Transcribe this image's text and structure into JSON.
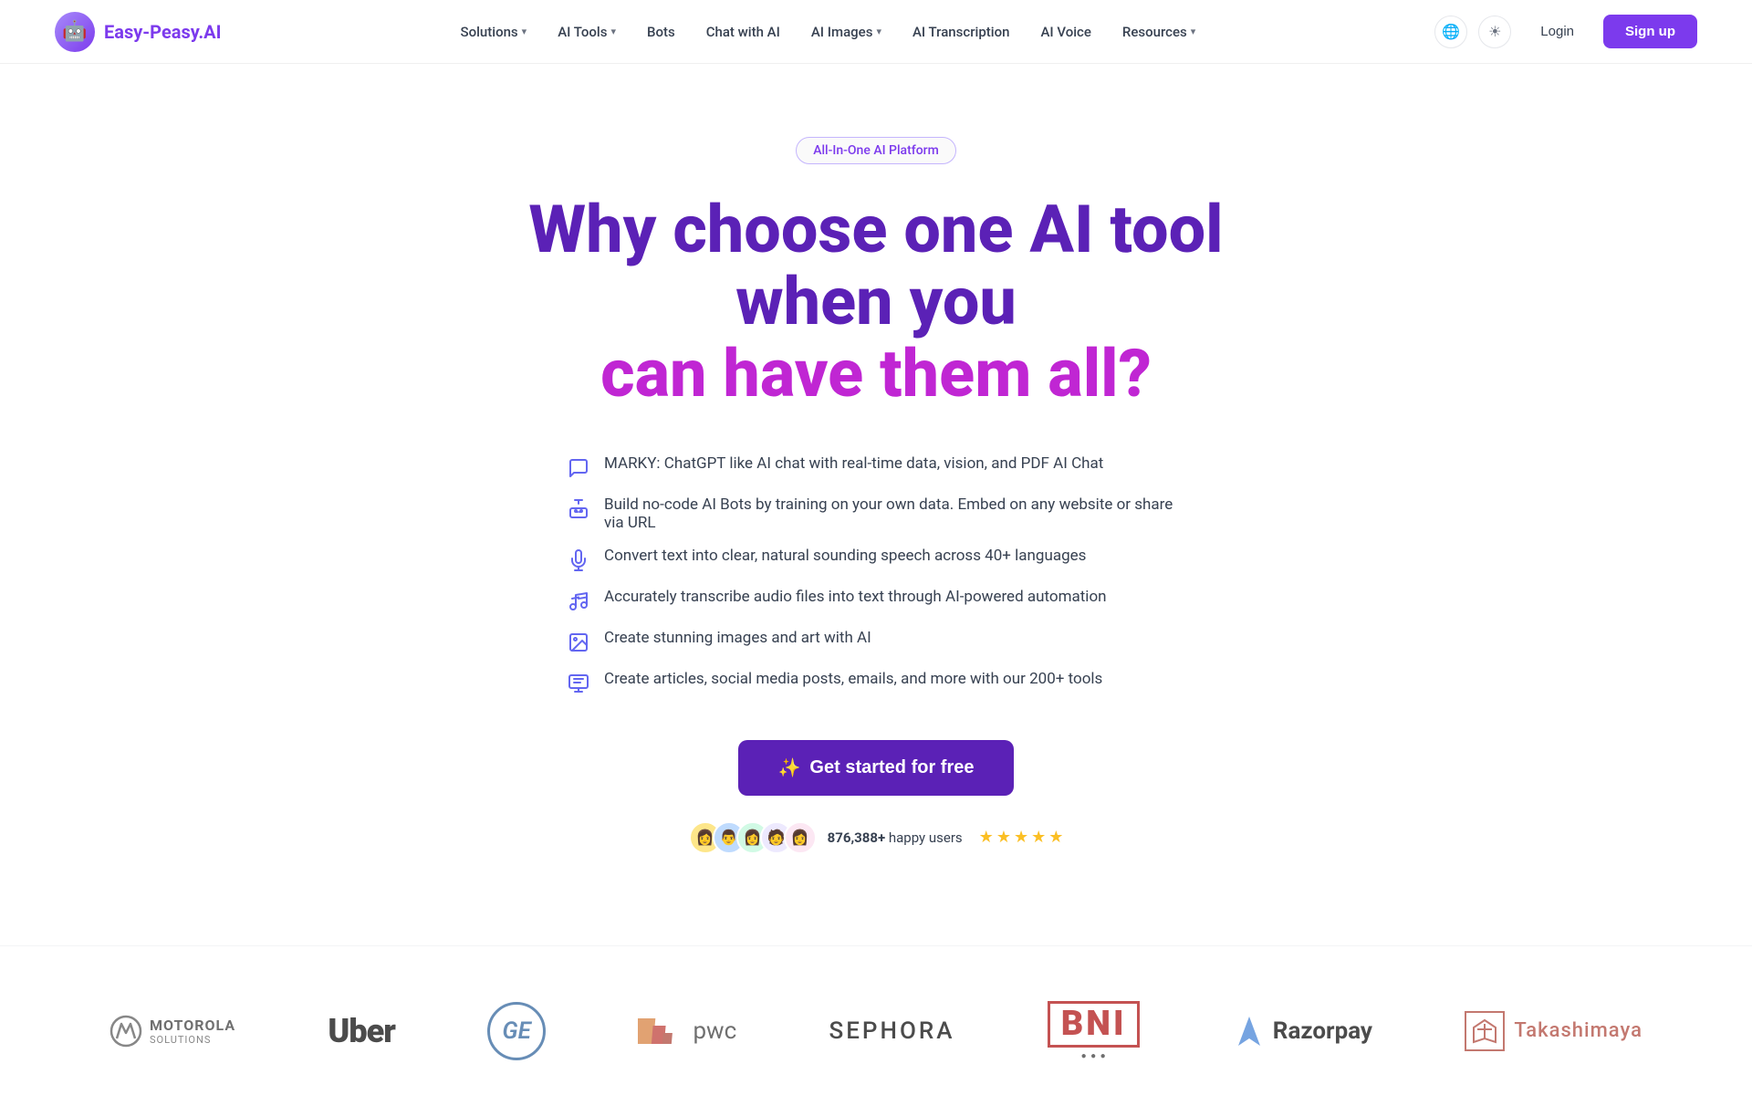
{
  "brand": {
    "logo_emoji": "🤖",
    "name_part1": "Easy-Peasy",
    "name_part2": ".AI"
  },
  "nav": {
    "items": [
      {
        "label": "Solutions",
        "has_dropdown": true
      },
      {
        "label": "AI Tools",
        "has_dropdown": true
      },
      {
        "label": "Bots",
        "has_dropdown": false
      },
      {
        "label": "Chat with AI",
        "has_dropdown": false
      },
      {
        "label": "AI Images",
        "has_dropdown": true
      },
      {
        "label": "AI Transcription",
        "has_dropdown": false
      },
      {
        "label": "AI Voice",
        "has_dropdown": false
      },
      {
        "label": "Resources",
        "has_dropdown": true
      }
    ],
    "login_label": "Login",
    "signup_label": "Sign up"
  },
  "hero": {
    "badge": "All-In-One AI Platform",
    "heading_line1_purple": "Why choose one AI tool when you",
    "heading_line2_magenta": "can have them all?",
    "features": [
      {
        "icon": "💬",
        "text": "MARKY: ChatGPT like AI chat with real-time data, vision, and PDF AI Chat"
      },
      {
        "icon": "🤖",
        "text": "Build no-code AI Bots by training on your own data. Embed on any website or share via URL"
      },
      {
        "icon": "🎤",
        "text": "Convert text into clear, natural sounding speech across 40+ languages"
      },
      {
        "icon": "🎵",
        "text": "Accurately transcribe audio files into text through AI-powered automation"
      },
      {
        "icon": "🖼️",
        "text": "Create stunning images and art with AI"
      },
      {
        "icon": "🗂️",
        "text": "Create articles, social media posts, emails, and more with our 200+ tools"
      }
    ],
    "cta_label": "Get started for free",
    "cta_icon": "✨",
    "social_proof": {
      "count": "876,388+",
      "label": "happy users",
      "stars": 5,
      "avatars": [
        "👩",
        "👨",
        "👩",
        "🧑",
        "👩"
      ]
    }
  },
  "logos": {
    "companies": [
      {
        "name": "Motorola Solutions"
      },
      {
        "name": "Uber"
      },
      {
        "name": "GE"
      },
      {
        "name": "PwC"
      },
      {
        "name": "SEPHORA"
      },
      {
        "name": "BNI"
      },
      {
        "name": "Razorpay"
      },
      {
        "name": "Takashimaya"
      }
    ]
  }
}
